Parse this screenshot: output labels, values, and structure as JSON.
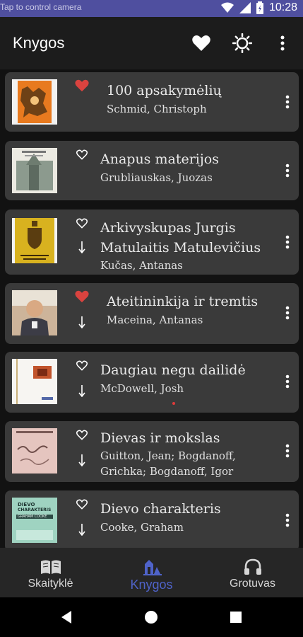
{
  "status": {
    "hint": "Tap to control camera",
    "time": "10:28"
  },
  "appbar": {
    "title": "Knygos",
    "icons": [
      "heart-icon",
      "brightness-icon",
      "more-vert-icon"
    ]
  },
  "books": [
    {
      "title": "100 apsakymėlių",
      "author": "Schmid, Christoph",
      "favorite": true,
      "downloadable": false,
      "cover": "orange-illustration"
    },
    {
      "title": "Anapus materijos",
      "author": "Grubliauskas, Juozas",
      "favorite": false,
      "downloadable": false,
      "cover": "church-photo"
    },
    {
      "title": "Arkivyskupas Jurgis Matulaitis Matulevičius",
      "title_l1": "Arkivyskupas Jurgis",
      "title_l2": "Matulaitis Matulevičius",
      "author": "Kučas, Antanas",
      "favorite": false,
      "downloadable": true,
      "cover": "yellow-coat-of-arms"
    },
    {
      "title": "Ateitininkija ir tremtis",
      "author": "Maceina, Antanas",
      "favorite": true,
      "downloadable": true,
      "cover": "portrait-photo"
    },
    {
      "title": "Daugiau negu dailidė",
      "author": "McDowell, Josh",
      "favorite": false,
      "downloadable": true,
      "cover": "white-cover"
    },
    {
      "title": "Dievas ir mokslas",
      "author": "Guitton, Jean; Bogdanoff, Grichka; Bogdanoff, Igor",
      "author_l1": "Guitton, Jean; Bogdanoff,",
      "author_l2": "Grichka; Bogdanoff, Igor",
      "favorite": false,
      "downloadable": true,
      "cover": "pink-handwriting"
    },
    {
      "title": "Dievo charakteris",
      "author": "Cooke, Graham",
      "favorite": false,
      "downloadable": true,
      "cover": "teal-cover",
      "cover_text_1": "DIEVO",
      "cover_text_2": "CHARAKTERIS",
      "cover_text_3": "GRAHAM COOKE"
    }
  ],
  "bottom_nav": [
    {
      "label": "Skaityklė",
      "icon": "book-open-icon",
      "active": false
    },
    {
      "label": "Knygos",
      "icon": "library-icon",
      "active": true
    },
    {
      "label": "Grotuvas",
      "icon": "headphones-icon",
      "active": false
    }
  ],
  "colors": {
    "accent": "#4f63c9",
    "favorite": "#d9433f",
    "card": "#3a3a3a",
    "statusbar": "#4f4f9f"
  }
}
